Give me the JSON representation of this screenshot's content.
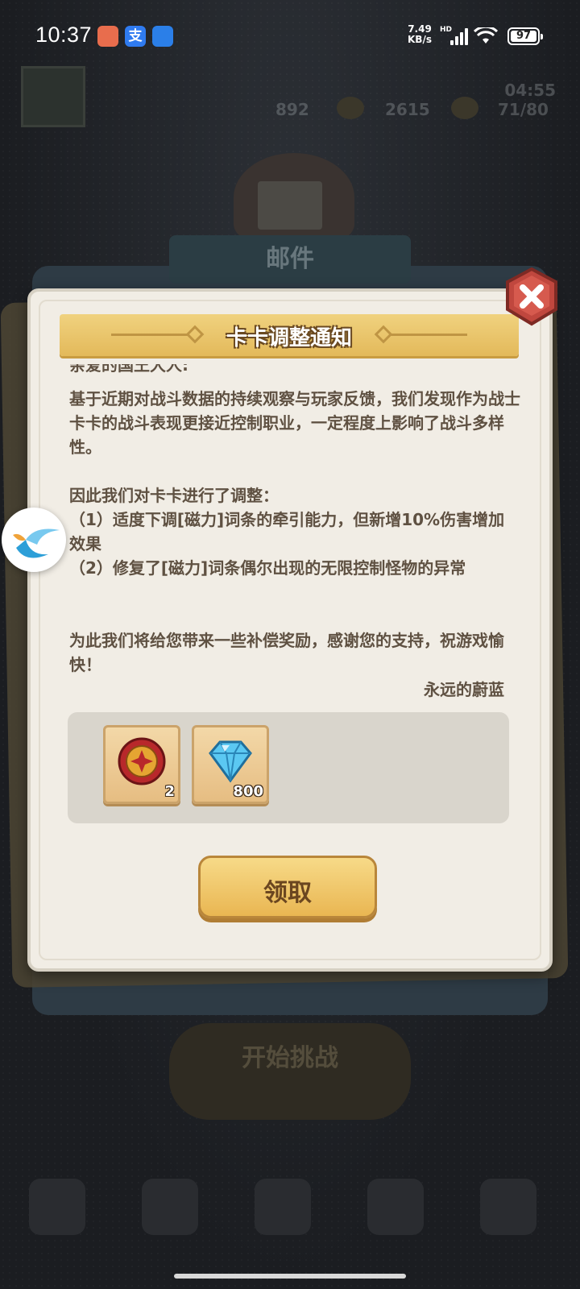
{
  "status_bar": {
    "time": "10:37",
    "speed_value": "7.49",
    "speed_unit": "KB/s",
    "network": "HD",
    "battery": "97"
  },
  "background": {
    "hud_values": [
      "892",
      "2615",
      "71/80"
    ],
    "timer": "04:55",
    "bg_title": "邮件",
    "start_button": "开始挑战"
  },
  "mail": {
    "title": "卡卡调整通知",
    "greeting": "亲爱的国王大人:",
    "paragraphs": [
      "基于近期对战斗数据的持续观察与玩家反馈，我们发现作为战士卡卡的战斗表现更接近控制职业，一定程度上影响了战斗多样性。",
      "因此我们对卡卡进行了调整：",
      "（1）适度下调[磁力]词条的牵引能力，但新增10%伤害增加效果",
      "（2）修复了[磁力]词条偶尔出现的无限控制怪物的异常",
      "为此我们将给您带来一些补偿奖励，感谢您的支持，祝游戏愉快！"
    ],
    "signature": "永远的蔚蓝",
    "rewards": [
      {
        "icon": "coin-token-icon",
        "quantity": "2"
      },
      {
        "icon": "diamond-icon",
        "quantity": "800"
      }
    ],
    "claim_label": "领取"
  },
  "colors": {
    "dialog_bg": "#f1ede5",
    "ribbon": "#e8c066",
    "button": "#f0c96a",
    "text": "#5f5142",
    "close": "#c0473e"
  }
}
